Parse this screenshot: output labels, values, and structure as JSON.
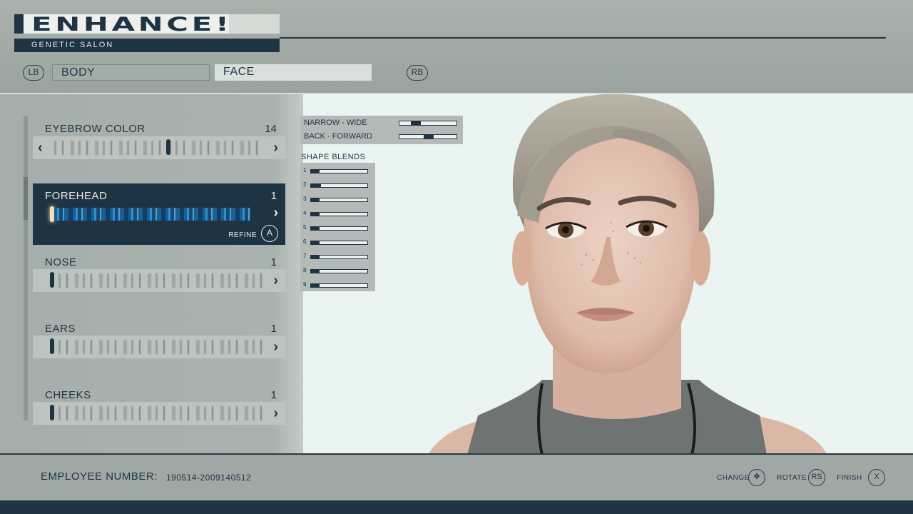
{
  "header": {
    "title": "ENHANCE!",
    "subtitle": "GENETIC SALON",
    "lb": "LB",
    "rb": "RB",
    "tabs": [
      {
        "label": "BODY",
        "active": false
      },
      {
        "label": "FACE",
        "active": true
      }
    ]
  },
  "features": [
    {
      "label": "EYEBROW COLOR",
      "value": "14",
      "level": 0.55
    },
    {
      "label": "FOREHEAD",
      "value": "1",
      "level": 0.0,
      "selected": true,
      "refine_label": "REFINE",
      "refine_button": "A"
    },
    {
      "label": "NOSE",
      "value": "1",
      "level": 0.0
    },
    {
      "label": "EARS",
      "value": "1",
      "level": 0.0
    },
    {
      "label": "CHEEKS",
      "value": "1",
      "level": 0.0
    }
  ],
  "adjustments": [
    {
      "label": "NARROW - WIDE",
      "level": 0.2
    },
    {
      "label": "BACK - FORWARD",
      "level": 0.42
    }
  ],
  "shape_blends": {
    "title": "SHAPE BLENDS",
    "items": [
      {
        "num": "1",
        "level": 0.15
      },
      {
        "num": "2",
        "level": 0.18
      },
      {
        "num": "3",
        "level": 0.15
      },
      {
        "num": "4",
        "level": 0.15
      },
      {
        "num": "5",
        "level": 0.15
      },
      {
        "num": "6",
        "level": 0.15
      },
      {
        "num": "7",
        "level": 0.15
      },
      {
        "num": "8",
        "level": 0.15
      },
      {
        "num": "9",
        "level": 0.15
      }
    ]
  },
  "footer": {
    "employee_label": "EMPLOYEE NUMBER:",
    "employee_number": "190514-2009140512",
    "controls": [
      {
        "label": "CHANGE",
        "button": "✥"
      },
      {
        "label": "ROTATE",
        "button": "RS"
      },
      {
        "label": "FINISH",
        "button": "X"
      }
    ]
  },
  "colors": {
    "accent": "#1f3443",
    "selection_glow": "#2f8fd0",
    "background": "#eaf4f1"
  }
}
